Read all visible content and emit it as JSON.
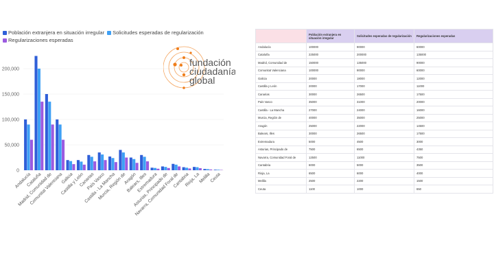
{
  "chart_data": {
    "type": "bar",
    "categories": [
      "Andalucía",
      "Cataluña",
      "Madrid, Comunidad de",
      "Comunitat Valenciana",
      "Galicia",
      "Castilla y León",
      "Canarias",
      "País Vasco",
      "Castilla - La Mancha",
      "Murcia, Región de",
      "Aragón",
      "Balears, Illes",
      "Extremadura",
      "Asturias, Principado de",
      "Navarra, Comunidad Foral de",
      "Cantabria",
      "Rioja, La",
      "Melilla",
      "Ceuta"
    ],
    "series": [
      {
        "name": "Población extranjera en situación irregular",
        "color": "#2f5fd8",
        "values": [
          100000,
          225000,
          150000,
          100000,
          20000,
          20000,
          30000,
          35000,
          27000,
          40000,
          25000,
          30000,
          5000,
          7500,
          12500,
          6000,
          6500,
          2500,
          1100
        ]
      },
      {
        "name": "Solicitudes esperadas de regularización",
        "color": "#3ea0f5",
        "values": [
          90000,
          200000,
          135000,
          90000,
          18000,
          17000,
          26500,
          31000,
          24000,
          35000,
          22000,
          26500,
          4500,
          6500,
          11000,
          5000,
          6000,
          2200,
          1000
        ]
      },
      {
        "name": "Regularizaciones esperadas",
        "color": "#9b5be0",
        "values": [
          60000,
          135000,
          90000,
          60000,
          12000,
          11000,
          17500,
          20000,
          16000,
          25000,
          14500,
          17500,
          3000,
          4350,
          7500,
          3500,
          4000,
          1500,
          650
        ]
      }
    ],
    "yticks": [
      "0",
      "50,000",
      "100,000",
      "150,000",
      "200,000"
    ],
    "ylim": [
      0,
      230000
    ],
    "grid": true,
    "legend": "top-left"
  },
  "logo": {
    "line1": "fundación",
    "line2": "ciudadanía",
    "line3": "global",
    "color": "#ef7d1a"
  },
  "table": {
    "headers": [
      "",
      "Población extranjera en situación irregular",
      "Solicitudes esperadas de regularización",
      "Regularizaciones esperadas"
    ],
    "rows": [
      [
        "Andalucía",
        "100000",
        "90000",
        "60000"
      ],
      [
        "Cataluña",
        "225000",
        "200000",
        "135000"
      ],
      [
        "Madrid, Comunidad de",
        "150000",
        "135000",
        "90000"
      ],
      [
        "Comunitat Valenciana",
        "100000",
        "90000",
        "60000"
      ],
      [
        "Galicia",
        "20000",
        "18000",
        "12000"
      ],
      [
        "Castilla y León",
        "20000",
        "17000",
        "11000"
      ],
      [
        "Canarias",
        "30000",
        "26500",
        "17500"
      ],
      [
        "País Vasco",
        "35000",
        "31000",
        "20000"
      ],
      [
        "Castilla - La Mancha",
        "27000",
        "24000",
        "16000"
      ],
      [
        "Murcia, Región de",
        "40000",
        "35000",
        "25000"
      ],
      [
        "Aragón",
        "25000",
        "22000",
        "14500"
      ],
      [
        "Balears, Illes",
        "30000",
        "26500",
        "17500"
      ],
      [
        "Extremadura",
        "5000",
        "4500",
        "3000"
      ],
      [
        "Asturias, Principado de",
        "7500",
        "6500",
        "4350"
      ],
      [
        "Navarra, Comunidad Foral de",
        "12500",
        "11000",
        "7500"
      ],
      [
        "Cantabria",
        "6000",
        "5000",
        "3500"
      ],
      [
        "Rioja, La",
        "6500",
        "6000",
        "4000"
      ],
      [
        "Melilla",
        "2500",
        "2200",
        "1500"
      ],
      [
        "Ceuta",
        "1100",
        "1000",
        "650"
      ]
    ]
  }
}
